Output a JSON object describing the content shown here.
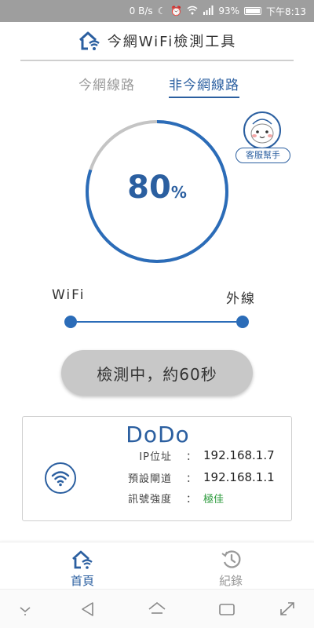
{
  "status_bar": {
    "net_speed": "0 B/s",
    "battery_pct": "93%",
    "time": "下午8:13",
    "notification_count": "1"
  },
  "header": {
    "title": "今網WiFi檢測工具",
    "logo_icon": "house-wifi-icon"
  },
  "tabs": [
    {
      "label": "今網線路",
      "active": false
    },
    {
      "label": "非今網線路",
      "active": true
    }
  ],
  "gauge": {
    "value": "80",
    "unit": "%",
    "progress": 0.8,
    "colors": {
      "fill": "#2b6cb8",
      "track": "#c4c4c4"
    }
  },
  "helper": {
    "label": "客服幫手",
    "icon": "mascot-face-icon"
  },
  "route": {
    "left_label": "WiFi",
    "right_label": "外線"
  },
  "test_button": {
    "label": "檢測中，約60秒"
  },
  "network": {
    "ssid": "DoDo",
    "rows": [
      {
        "key": "IP位址",
        "colon": "：",
        "value": "192.168.1.7"
      },
      {
        "key": "預設閘道",
        "colon": "：",
        "value": "192.168.1.1"
      },
      {
        "key": "訊號強度",
        "colon": "：",
        "value": "極佳"
      }
    ],
    "signal_color": "#2e9b3e"
  },
  "bottom_nav": [
    {
      "label": "首頁",
      "icon": "home-wifi-icon",
      "active": true
    },
    {
      "label": "紀錄",
      "icon": "history-icon",
      "active": false
    }
  ],
  "colors": {
    "accent": "#2b5fa0",
    "button_bg": "#c8c8c8",
    "statusbar_bg": "#9e9e9e"
  }
}
